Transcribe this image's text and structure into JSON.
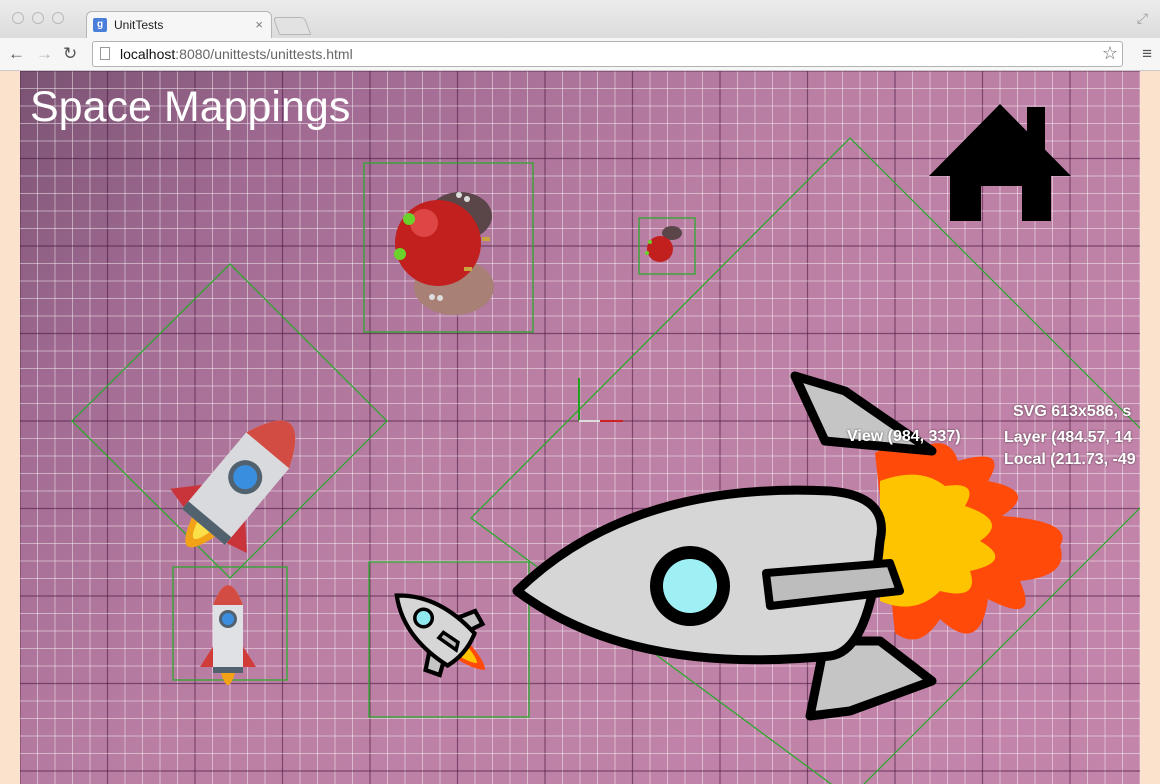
{
  "browser": {
    "tab_title": "UnitTests",
    "tab_close": "×",
    "url_host": "localhost",
    "url_path": ":8080/unittests/unittests.html"
  },
  "page": {
    "title": "Space Mappings",
    "view_label": "View (984, 337)",
    "svg_label": "SVG 613x586, s",
    "layer_label": "Layer (484.57, 14",
    "local_label": "Local (211.73, -49"
  },
  "icons": {
    "back": "back-arrow-icon",
    "forward": "forward-arrow-icon",
    "reload": "reload-icon",
    "bookmark": "star-icon",
    "menu": "hamburger-menu-icon",
    "home": "home-icon"
  },
  "colors": {
    "bounds": "#2ea82e",
    "stage_bg": "#c485ab",
    "page_bg": "#fbe2cc"
  }
}
